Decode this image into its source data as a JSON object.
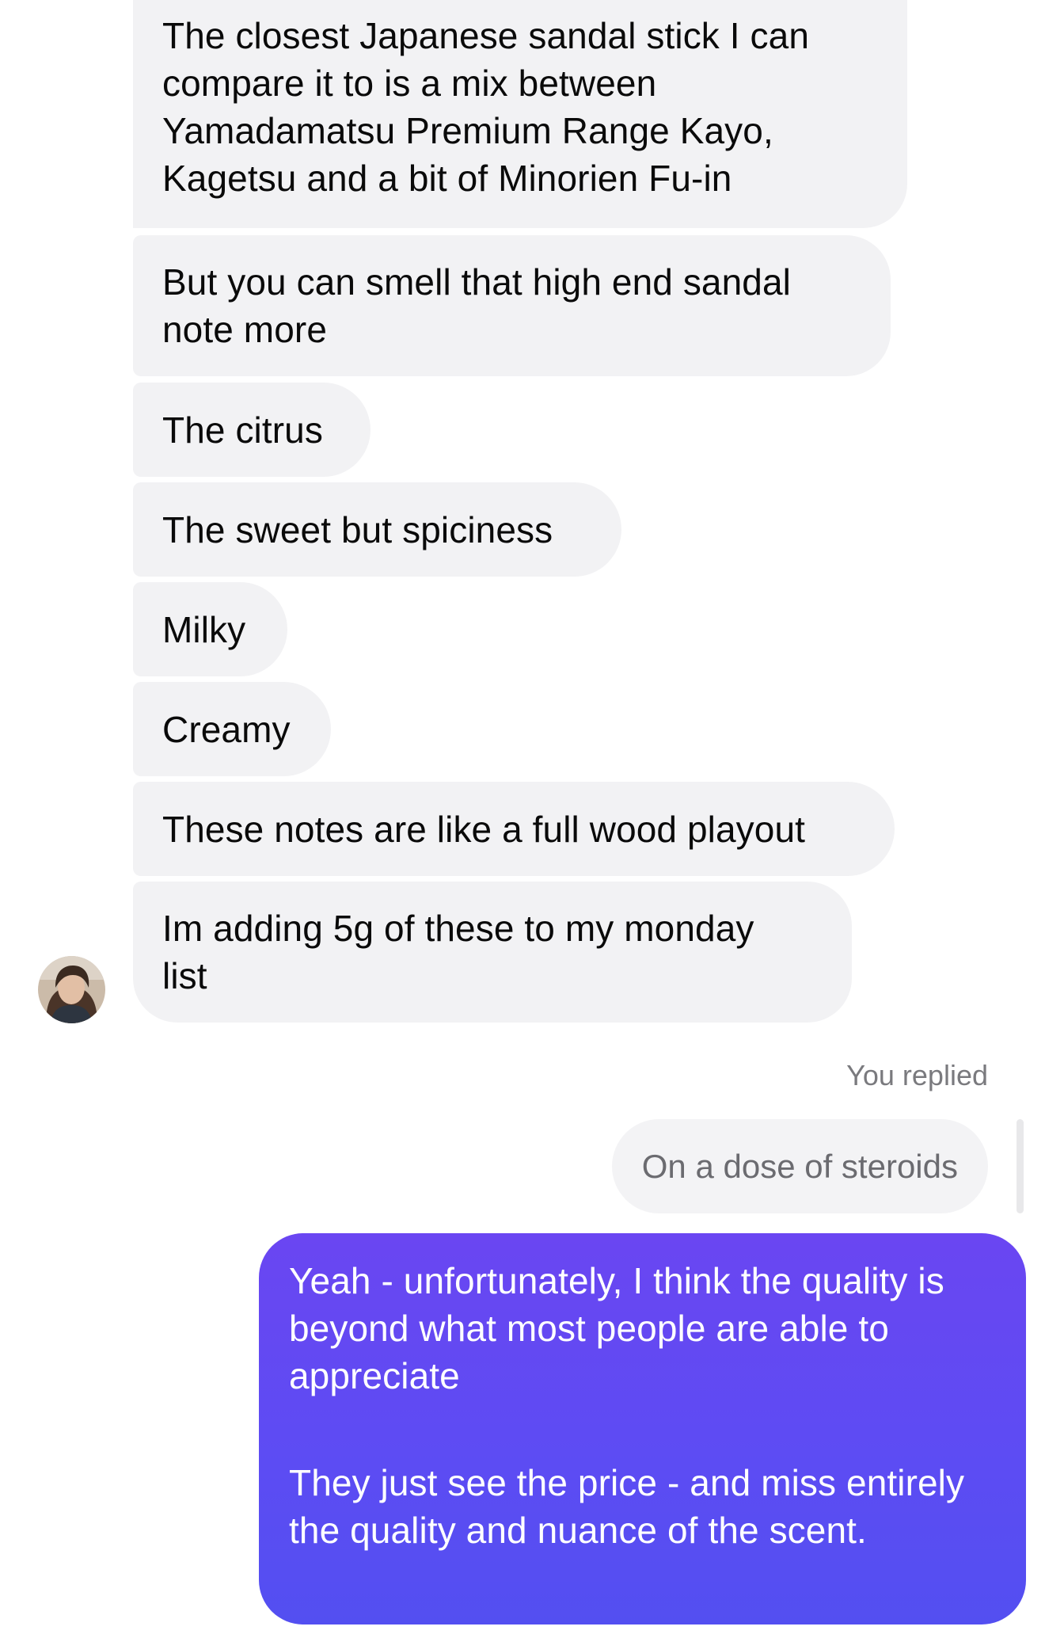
{
  "conversation": {
    "incoming_messages": [
      "The closest Japanese sandal stick I can compare it to is a mix between Yamadamatsu Premium Range Kayo, Kagetsu and a bit of Minorien Fu-in",
      "But you can smell that high end sandal note more",
      "The citrus",
      "The sweet but spiciness",
      "Milky",
      "Creamy",
      "These notes are like a full wood playout",
      "Im adding 5g of these to my monday list"
    ],
    "reply_label": "You replied",
    "quoted_message": "On a dose of steroids",
    "outgoing_message": {
      "paragraph_1": "Yeah - unfortunately, I think the quality is beyond what most people are able to appreciate",
      "paragraph_2": "They just see the price - and miss entirely the quality and nuance of the scent."
    }
  },
  "colors": {
    "incoming_bubble": "#f2f2f4",
    "outgoing_bubble": "#5c4cf3",
    "reply_label": "#7a7a7e"
  }
}
